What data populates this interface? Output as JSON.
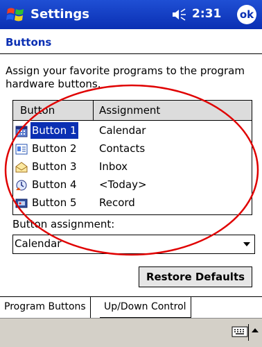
{
  "titlebar": {
    "app": "Settings",
    "time": "2:31",
    "ok": "ok"
  },
  "heading": "Buttons",
  "description": "Assign your favorite programs to the program hardware buttons.",
  "list": {
    "headers": {
      "button": "Button",
      "assignment": "Assignment"
    },
    "rows": [
      {
        "button": "Button 1",
        "assignment": "Calendar",
        "icon": "calendar-icon",
        "selected": true
      },
      {
        "button": "Button 2",
        "assignment": "Contacts",
        "icon": "contacts-icon",
        "selected": false
      },
      {
        "button": "Button 3",
        "assignment": "Inbox",
        "icon": "inbox-icon",
        "selected": false
      },
      {
        "button": "Button 4",
        "assignment": "<Today>",
        "icon": "today-icon",
        "selected": false
      },
      {
        "button": "Button 5",
        "assignment": "Record",
        "icon": "record-icon",
        "selected": false
      }
    ]
  },
  "assignment": {
    "label": "Button assignment:",
    "value": "Calendar"
  },
  "restore_label": "Restore Defaults",
  "tabs": [
    "Program Buttons",
    "Up/Down Control"
  ],
  "colors": {
    "titlebar": "#0a2fb3",
    "selection": "#0a2fb3",
    "annotation": "#e00000"
  }
}
